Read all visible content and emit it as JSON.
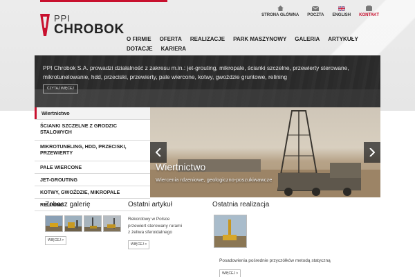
{
  "colors": {
    "brand_red": "#c8102e",
    "header_bg": "#e9e9e9",
    "banner_bg": "#3a3a3a",
    "text_dark": "#222222"
  },
  "logo": {
    "line1": "PPI",
    "line2": "CHROBOK"
  },
  "util_nav": [
    {
      "label": "STRONA GŁÓWNA",
      "icon": "home-icon"
    },
    {
      "label": "POCZTA",
      "icon": "mail-icon"
    },
    {
      "label": "ENGLISH",
      "icon": "uk-flag-icon"
    },
    {
      "label": "KONTAKT",
      "icon": "contact-icon"
    }
  ],
  "main_nav": [
    "O FIRMIE",
    "OFERTA",
    "REALIZACJE",
    "PARK MASZYNOWY",
    "GALERIA",
    "ARTYKUŁY",
    "DOTACJE",
    "KARIERA"
  ],
  "banner": {
    "text": "PPI Chrobok S.A. prowadzi działalność z zakresu m.in.: jet-grouting, mikropale, ścianki szczelne, przewierty sterowane, mikrotunelowanie, hdd, przeciski, przewierty, pale wiercone, kotwy, gwoździe gruntowe, relining",
    "button": "CZYTAJ WIĘCEJ"
  },
  "sidebar": [
    "Wiertnictwo",
    "ŚCIANKI SZCZELNE Z GRODZIC STALOWYCH",
    "MIKROTUNELING, HDD, PRZECISKI, PRZEWIERTY",
    "PALE WIERCONE",
    "JET-GROUTING",
    "KOTWY, GWOŹDZIE, MIKROPALE",
    "RELINING"
  ],
  "slider": {
    "title": "Wiertnictwo",
    "subtitle": "Wiercenia rdzeniowe, geologiczno-poszukiwawcze"
  },
  "gallery": {
    "title": "Zobacz galerię",
    "more": "WIĘCEJ >"
  },
  "article": {
    "title": "Ostatni artykuł",
    "text": "Rekordowy w Polsce przewiert sterowany rurami z żeliwa sferoidalnego",
    "more": "WIĘCEJ >"
  },
  "realization": {
    "title": "Ostatnia realizacja",
    "text": "Posadowienia pośrednie przyczółków metodą statyczną",
    "more": "WIĘCEJ >"
  }
}
